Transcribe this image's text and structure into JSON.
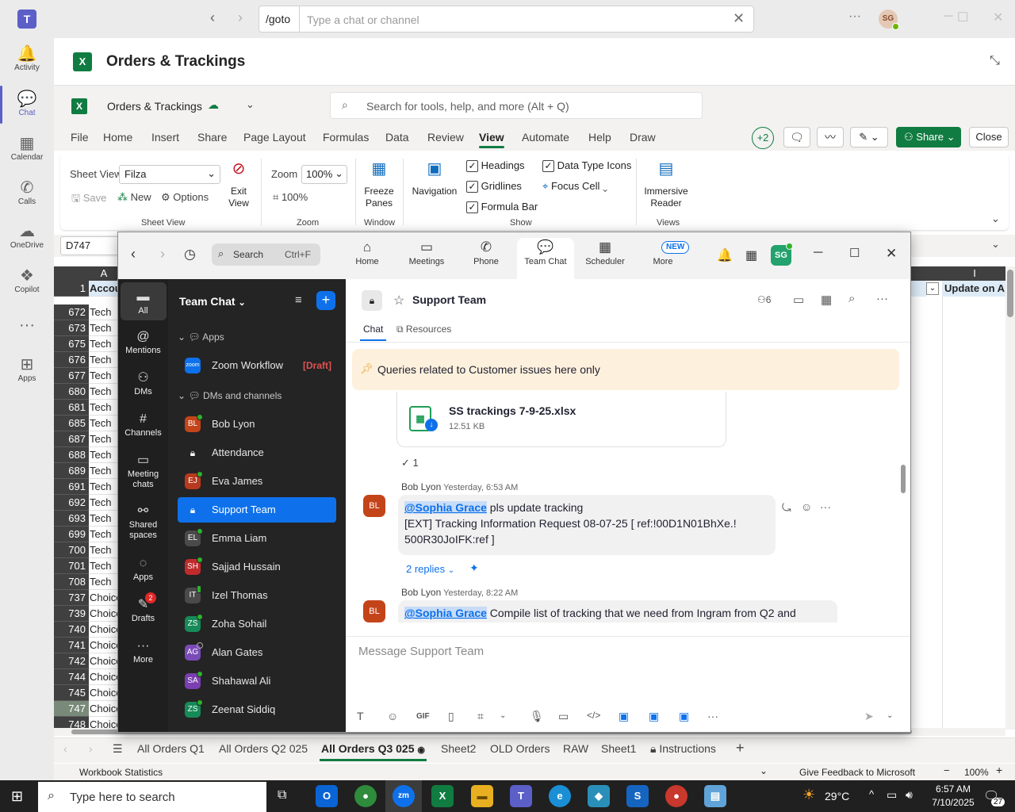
{
  "teams": {
    "goto_label": "/goto",
    "search_placeholder": "Type a chat or channel",
    "avatar_initials": "SG",
    "rail": [
      {
        "label": "Activity",
        "icon": "bell-icon"
      },
      {
        "label": "Chat",
        "icon": "chat-icon"
      },
      {
        "label": "Calendar",
        "icon": "calendar-icon"
      },
      {
        "label": "Calls",
        "icon": "phone-icon"
      },
      {
        "label": "OneDrive",
        "icon": "cloud-icon"
      },
      {
        "label": "Copilot",
        "icon": "copilot-icon"
      },
      {
        "label": "",
        "icon": "more-icon"
      },
      {
        "label": "Apps",
        "icon": "apps-icon"
      }
    ]
  },
  "excel": {
    "window_title": "Orders & Trackings",
    "doc_title": "Orders & Trackings",
    "search_placeholder": "Search for tools, help, and more (Alt + Q)",
    "tabs": [
      "File",
      "Home",
      "Insert",
      "Share",
      "Page Layout",
      "Formulas",
      "Data",
      "Review",
      "View",
      "Automate",
      "Help",
      "Draw"
    ],
    "active_tab": "View",
    "collab_count": "+2",
    "share_label": "Share",
    "close_label": "Close",
    "ribbon": {
      "sheet_view_label": "Sheet View",
      "sheet_view_value": "Filza",
      "save": "Save",
      "new": "New",
      "options": "Options",
      "exit_view": "Exit View",
      "group_sheet_view": "Sheet View",
      "zoom_label": "Zoom",
      "zoom_value": "100%",
      "zoom_100": "100%",
      "group_zoom": "Zoom",
      "freeze_panes": "Freeze Panes",
      "group_window": "Window",
      "navigation": "Navigation",
      "headings": "Headings",
      "gridlines": "Gridlines",
      "formula_bar": "Formula Bar",
      "data_type_icons": "Data Type Icons",
      "focus_cell": "Focus Cell",
      "group_show": "Show",
      "immersive_reader": "Immersive Reader",
      "group_views": "Views"
    },
    "name_box": "D747",
    "col_a": "A",
    "col_i": "I",
    "header_row_num": "1",
    "header_cell_a": "Accou",
    "header_cell_i": "Update on Ar",
    "rows": [
      {
        "n": "672",
        "a": "Tech"
      },
      {
        "n": "673",
        "a": "Tech"
      },
      {
        "n": "675",
        "a": "Tech"
      },
      {
        "n": "676",
        "a": "Tech"
      },
      {
        "n": "677",
        "a": "Tech"
      },
      {
        "n": "680",
        "a": "Tech"
      },
      {
        "n": "681",
        "a": "Tech"
      },
      {
        "n": "685",
        "a": "Tech"
      },
      {
        "n": "687",
        "a": "Tech"
      },
      {
        "n": "688",
        "a": "Tech"
      },
      {
        "n": "689",
        "a": "Tech"
      },
      {
        "n": "691",
        "a": "Tech"
      },
      {
        "n": "692",
        "a": "Tech"
      },
      {
        "n": "693",
        "a": "Tech"
      },
      {
        "n": "699",
        "a": "Tech"
      },
      {
        "n": "700",
        "a": "Tech"
      },
      {
        "n": "701",
        "a": "Tech"
      },
      {
        "n": "708",
        "a": "Tech"
      },
      {
        "n": "737",
        "a": "Choice"
      },
      {
        "n": "739",
        "a": "Choice"
      },
      {
        "n": "740",
        "a": "Choice"
      },
      {
        "n": "741",
        "a": "Choice"
      },
      {
        "n": "742",
        "a": "Choice"
      },
      {
        "n": "744",
        "a": "Choice"
      },
      {
        "n": "745",
        "a": "Choice"
      },
      {
        "n": "747",
        "a": "Choice"
      },
      {
        "n": "748",
        "a": "Choice"
      }
    ],
    "sheet_tabs": [
      "All Orders Q1",
      "All Orders Q2 025",
      "All Orders Q3 025",
      "Sheet2",
      "OLD Orders",
      "RAW",
      "Sheet1",
      "Instructions"
    ],
    "active_sheet": "All Orders Q3 025",
    "status_left": "Workbook Statistics",
    "status_feedback": "Give Feedback to Microsoft",
    "status_zoom": "100%"
  },
  "zoom": {
    "search_label": "Search",
    "search_shortcut": "Ctrl+F",
    "top_nav": [
      "Home",
      "Meetings",
      "Phone",
      "Team Chat",
      "Scheduler",
      "More"
    ],
    "new_badge": "NEW",
    "avatar": "SG",
    "side": [
      {
        "label": "All",
        "icon": "chat-bubble-icon"
      },
      {
        "label": "Mentions",
        "icon": "at-icon"
      },
      {
        "label": "DMs",
        "icon": "people-icon"
      },
      {
        "label": "Channels",
        "icon": "hash-icon"
      },
      {
        "label": "Meeting chats",
        "icon": "meeting-chat-icon"
      },
      {
        "label": "Shared spaces",
        "icon": "shared-spaces-icon"
      },
      {
        "label": "Apps",
        "icon": "apps-bubble-icon"
      },
      {
        "label": "Drafts",
        "icon": "drafts-icon"
      },
      {
        "label": "More",
        "icon": "ellipsis-icon"
      }
    ],
    "drafts_badge": "2",
    "list_title": "Team Chat",
    "section_apps": "Apps",
    "zoom_workflow": "Zoom Workflow",
    "draft_tag": "[Draft]",
    "section_dms": "DMs and channels",
    "contacts": [
      {
        "name": "Bob Lyon",
        "initials": "BL",
        "color": "#c4441a",
        "status": "online"
      },
      {
        "name": "Attendance",
        "initials": "",
        "color": "#3a3a3a",
        "status": "lock"
      },
      {
        "name": "Eva James",
        "initials": "EJ",
        "color": "#b83a1e",
        "status": "online"
      },
      {
        "name": "Support Team",
        "initials": "",
        "color": "#0e71eb",
        "status": "lock"
      },
      {
        "name": "Emma Liam",
        "initials": "EL",
        "color": "#4a4a4a",
        "status": "online"
      },
      {
        "name": "Sajjad Hussain",
        "initials": "SH",
        "color": "#c02b2b",
        "status": "online"
      },
      {
        "name": "Izel Thomas",
        "initials": "IT",
        "color": "#4a4a4a",
        "status": "mobile"
      },
      {
        "name": "Zoha Sohail",
        "initials": "ZS",
        "color": "#168a58",
        "status": "online"
      },
      {
        "name": "Alan Gates",
        "initials": "AG",
        "color": "#7a4bb8",
        "status": "away"
      },
      {
        "name": "Shahawal Ali",
        "initials": "SA",
        "color": "#7a3fb0",
        "status": "online"
      },
      {
        "name": "Zeenat Siddiq",
        "initials": "ZS",
        "color": "#168a58",
        "status": "online"
      }
    ],
    "active_contact": "Support Team",
    "channel_title": "Support Team",
    "member_count": "6",
    "tab_chat": "Chat",
    "tab_resources": "Resources",
    "pinned": "Queries related to Customer issues here only",
    "file_name": "SS trackings 7-9-25.xlsx",
    "file_size": "12.51 KB",
    "reaction_count": "1",
    "msg1": {
      "author": "Bob Lyon",
      "time": "Yesterday, 6:53 AM",
      "mention": "@Sophia Grace",
      "text1": " pls update tracking",
      "text2": "[EXT] Tracking Information Request  08-07-25    [ ref:!00D1N01BhXe.!",
      "text3": "500R30JoIFK:ref ]",
      "replies": "2 replies"
    },
    "msg2": {
      "author": "Bob Lyon",
      "time": "Yesterday, 8:22 AM",
      "mention": "@Sophia Grace",
      "text1": " Compile list of tracking that we need from Ingram from Q2 and"
    },
    "compose_placeholder": "Message Support Team"
  },
  "taskbar": {
    "search_placeholder": "Type here to search",
    "weather": "29°C",
    "time": "6:57 AM",
    "date": "7/10/2025",
    "notif_count": "27"
  }
}
